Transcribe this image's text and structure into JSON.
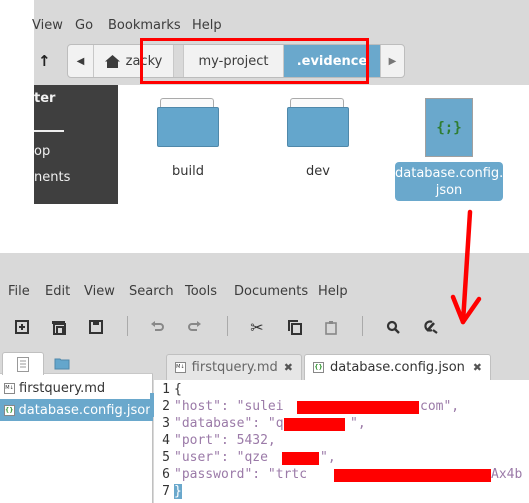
{
  "file_manager": {
    "menu": [
      "View",
      "Go",
      "Bookmarks",
      "Help"
    ],
    "up_icon": "arrow-up-icon",
    "pathbar": {
      "back_icon": "chevron-left-icon",
      "home_icon": "home-icon",
      "home_label": "zacky",
      "segments": [
        "my-project",
        ".evidence"
      ],
      "active_segment": ".evidence",
      "forward_icon": "chevron-right-icon"
    },
    "sidebar": {
      "title": "ter",
      "items": [
        "op",
        "nents"
      ]
    },
    "items": [
      {
        "name": "build",
        "type": "folder"
      },
      {
        "name": "dev",
        "type": "folder"
      },
      {
        "name": "database.config.json",
        "name_line1": "database.config.",
        "name_line2": "json",
        "type": "json",
        "icon_glyph": "{;}",
        "selected": true
      }
    ],
    "annotation_color": "#ff0000"
  },
  "editor": {
    "menu": [
      "File",
      "Edit",
      "View",
      "Search",
      "Tools",
      "Documents",
      "Help"
    ],
    "toolbar": [
      "new-document-icon",
      "open-icon",
      "save-icon",
      "undo-icon",
      "redo-icon",
      "cut-icon",
      "copy-icon",
      "paste-icon",
      "search-icon",
      "replace-icon"
    ],
    "side_panel": {
      "tabs": [
        "documents-icon",
        "folder-icon"
      ],
      "documents": [
        {
          "name": "firstquery.md",
          "icon": "M↓",
          "selected": false
        },
        {
          "name": "database.config.json",
          "icon": "{}",
          "selected": true
        }
      ]
    },
    "tabs": [
      {
        "label": "firstquery.md",
        "icon": "M↓",
        "active": false,
        "close": "✖"
      },
      {
        "label": "database.config.json",
        "icon": "{}",
        "active": true,
        "close": "✖"
      }
    ],
    "lines": [
      {
        "n": "1",
        "text": "{"
      },
      {
        "n": "2",
        "text": "\"host\": \"sulei",
        "tail": "com\","
      },
      {
        "n": "3",
        "text": "\"database\": \"q",
        "tail": "\","
      },
      {
        "n": "4",
        "text": "\"port\": 5432,"
      },
      {
        "n": "5",
        "text": "\"user\": \"qze",
        "tail": "\","
      },
      {
        "n": "6",
        "text": "\"password\": \"trtc",
        "tail": "Ax4b"
      },
      {
        "n": "7",
        "text": "}"
      }
    ]
  },
  "colors": {
    "accent": "#6aa8cc",
    "annotation": "#ff0000",
    "menubar_bg": "#d9d9d9",
    "sidebar_bg": "#3f3f3f",
    "string_color": "#9b7aa8"
  }
}
